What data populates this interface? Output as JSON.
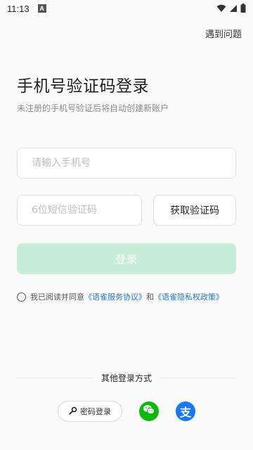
{
  "status_bar": {
    "time": "11:13",
    "notification_glyph": "A",
    "icons": [
      "wifi-icon",
      "signal-icon",
      "battery-icon"
    ]
  },
  "header": {
    "help_link": "遇到问题"
  },
  "login": {
    "title": "手机号验证码登录",
    "subtitle": "未注册的手机号验证后将自动创建新账户",
    "phone_placeholder": "请输入手机号",
    "phone_value": "",
    "code_placeholder": "6位短信验证码",
    "code_value": "",
    "get_code_label": "获取验证码",
    "login_label": "登录"
  },
  "agreement": {
    "prefix": "我已阅读并同意",
    "service_link": "《语雀服务协议》",
    "conjunction": "和",
    "privacy_link": "《语雀隐私权政策》",
    "checked": false
  },
  "other_login": {
    "heading": "其他登录方式",
    "password_label": "密码登录",
    "password_icon": "key-icon",
    "wechat_icon": "wechat-icon",
    "alipay_icon": "alipay-icon",
    "alipay_glyph": "支"
  },
  "colors": {
    "accent_disabled": "#c7ecd7",
    "link": "#1f7bd9",
    "wechat": "#09bb07",
    "alipay": "#1677ff"
  }
}
